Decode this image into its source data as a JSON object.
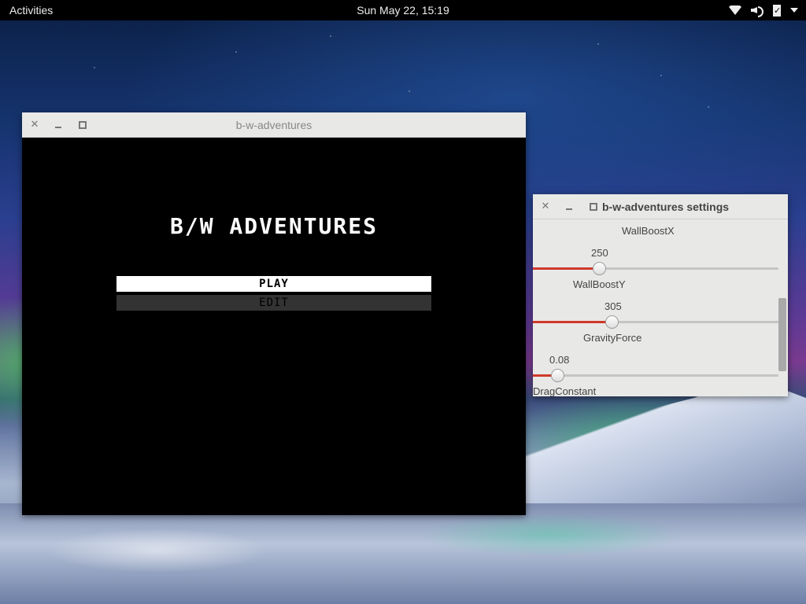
{
  "topbar": {
    "activities": "Activities",
    "clock": "Sun May 22, 15:19",
    "icons": [
      "wifi-icon",
      "speaker-icon",
      "battery-icon",
      "dropdown-icon"
    ]
  },
  "game_window": {
    "title": "b-w-adventures",
    "game_title": "B/W ADVENTURES",
    "buttons": {
      "play": "PLAY",
      "edit": "EDIT"
    },
    "selected": "play"
  },
  "settings_window": {
    "title": "b-w-adventures settings",
    "partial_label": "WallBoostX",
    "sliders": [
      {
        "label": "WallBoostY",
        "value": "250",
        "fraction": 0.27
      },
      {
        "label": "GravityForce",
        "value": "305",
        "fraction": 0.32
      },
      {
        "label": "DragConstant",
        "value": "0.08",
        "fraction": 0.1
      }
    ],
    "accent_color": "#d0392b"
  }
}
